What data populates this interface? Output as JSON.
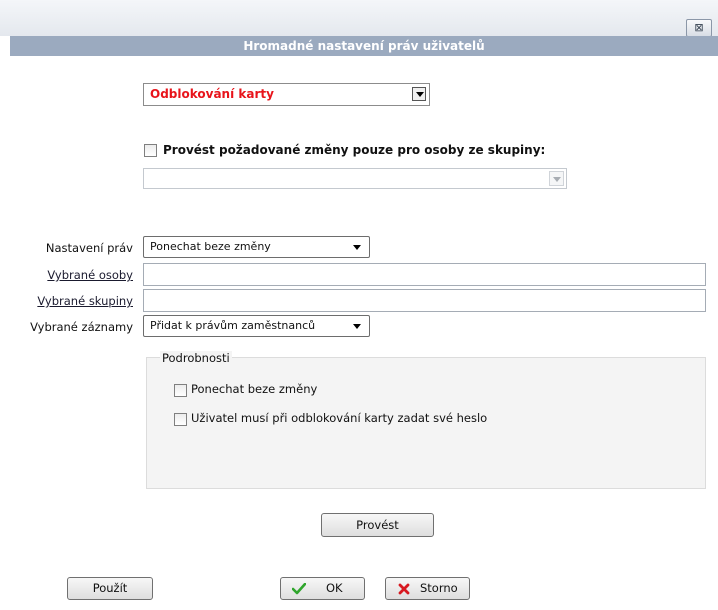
{
  "window": {
    "title": "Hromadné nastavení práv uživatelů",
    "close_glyph": "⊠"
  },
  "action_select": {
    "value": "Odblokování karty",
    "color": "#e8141b"
  },
  "group_restriction": {
    "checkbox_label": "Provést požadované změny pouze pro osoby ze skupiny:",
    "checked": false,
    "select_value": ""
  },
  "form": {
    "rights_label": "Nastavení práv",
    "rights_value": "Ponechat beze změny",
    "persons_label": "Vybrané osoby",
    "persons_value": "",
    "groups_label": "Vybrané skupiny",
    "groups_value": "",
    "records_label": "Vybrané záznamy",
    "records_value": "Přidat k právům zaměstnanců"
  },
  "details": {
    "title": "Podrobnosti",
    "options": [
      {
        "label": "Ponechat beze změny",
        "checked": false
      },
      {
        "label": "Uživatel musí při odblokování karty zadat své heslo",
        "checked": false
      }
    ]
  },
  "buttons": {
    "execute": "Provést",
    "apply": "Použít",
    "ok": "OK",
    "cancel": "Storno"
  },
  "icons": {
    "ok": "checkmark-icon",
    "cancel": "cross-icon"
  }
}
